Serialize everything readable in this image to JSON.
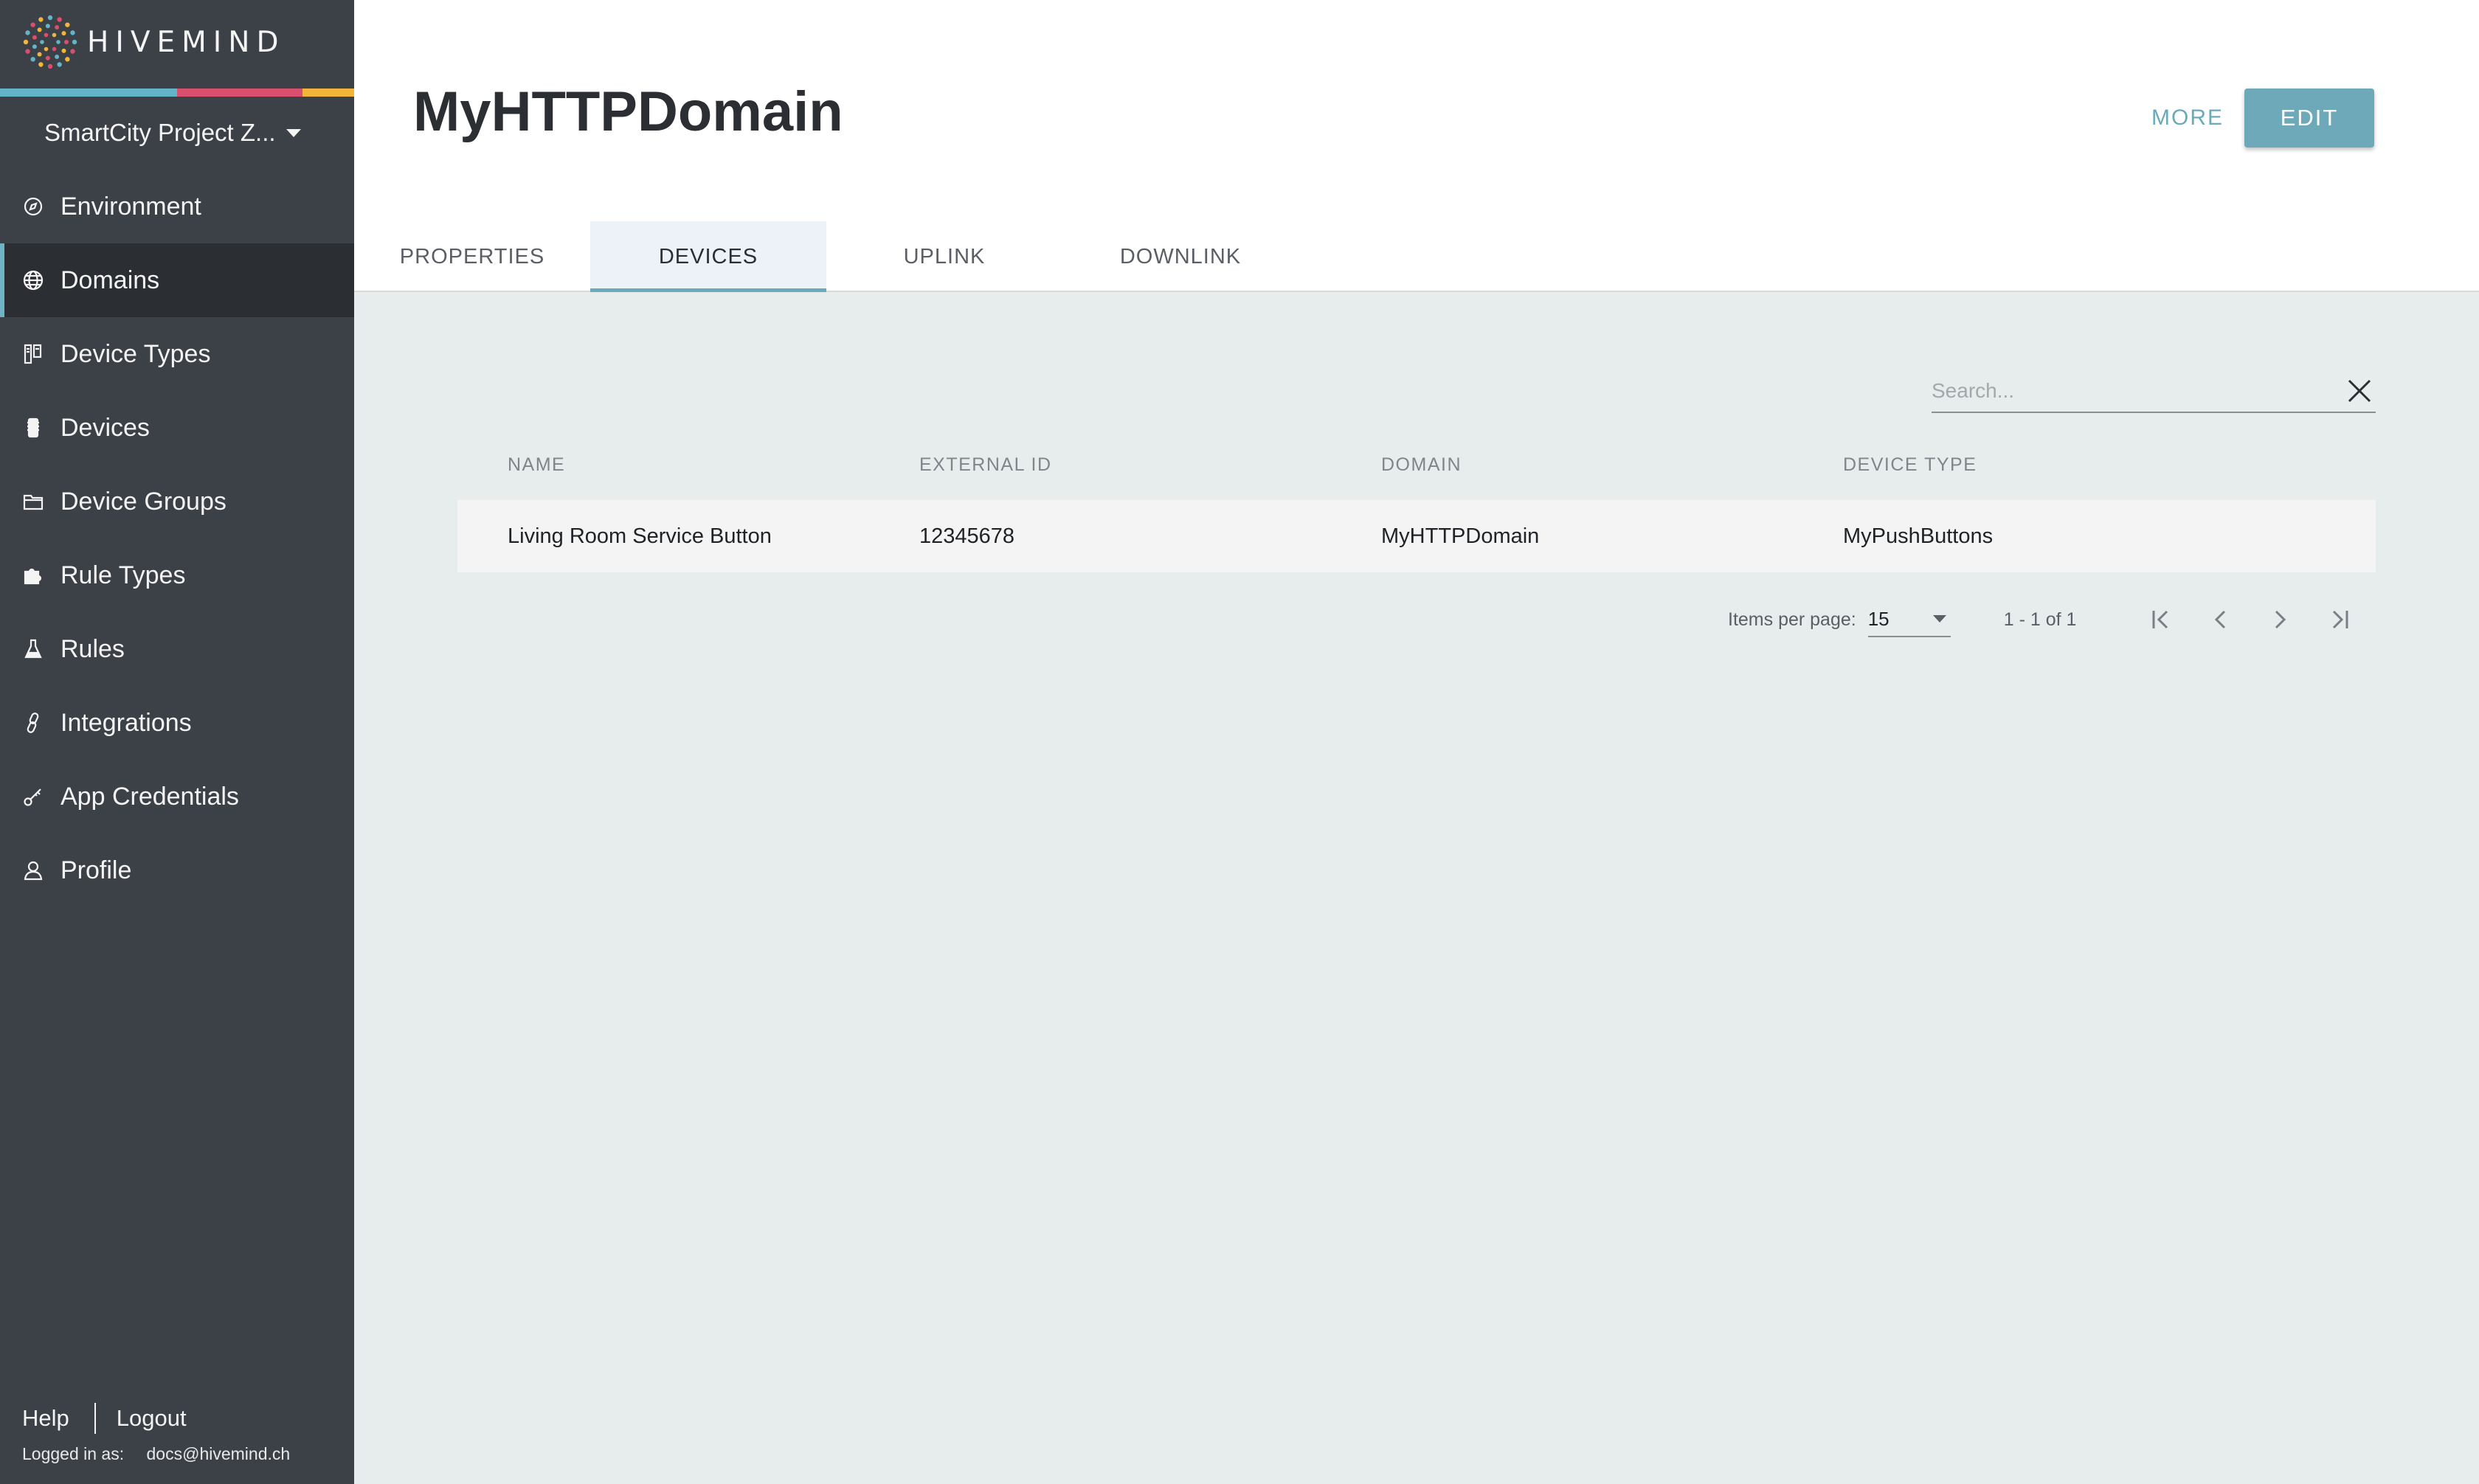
{
  "app": {
    "name": "HIVEMIND",
    "brand_colors": [
      "#64b4c8",
      "#d94f6f",
      "#f2b53a"
    ]
  },
  "project": {
    "label": "SmartCity Project Z..."
  },
  "sidebar": {
    "items": [
      {
        "label": "Environment",
        "icon": "environment-icon"
      },
      {
        "label": "Domains",
        "icon": "globe-icon",
        "active": true
      },
      {
        "label": "Device Types",
        "icon": "device-types-icon"
      },
      {
        "label": "Devices",
        "icon": "device-icon"
      },
      {
        "label": "Device Groups",
        "icon": "folder-icon"
      },
      {
        "label": "Rule Types",
        "icon": "puzzle-icon"
      },
      {
        "label": "Rules",
        "icon": "flask-icon"
      },
      {
        "label": "Integrations",
        "icon": "link-icon"
      },
      {
        "label": "App Credentials",
        "icon": "key-icon"
      },
      {
        "label": "Profile",
        "icon": "user-icon"
      }
    ],
    "footer": {
      "help": "Help",
      "logout": "Logout",
      "logged_in_label": "Logged in as:",
      "logged_in_user": "docs@hivemind.ch"
    }
  },
  "header": {
    "title": "MyHTTPDomain",
    "more_label": "MORE",
    "edit_label": "EDIT",
    "tabs": [
      {
        "label": "PROPERTIES"
      },
      {
        "label": "DEVICES",
        "active": true
      },
      {
        "label": "UPLINK"
      },
      {
        "label": "DOWNLINK"
      }
    ]
  },
  "search": {
    "placeholder": "Search...",
    "value": ""
  },
  "table": {
    "columns": [
      "NAME",
      "EXTERNAL ID",
      "DOMAIN",
      "DEVICE TYPE"
    ],
    "rows": [
      [
        "Living Room Service Button",
        "12345678",
        "MyHTTPDomain",
        "MyPushButtons"
      ]
    ]
  },
  "pagination": {
    "items_per_page_label": "Items per page:",
    "items_per_page": "15",
    "range": "1 - 1 of 1"
  }
}
